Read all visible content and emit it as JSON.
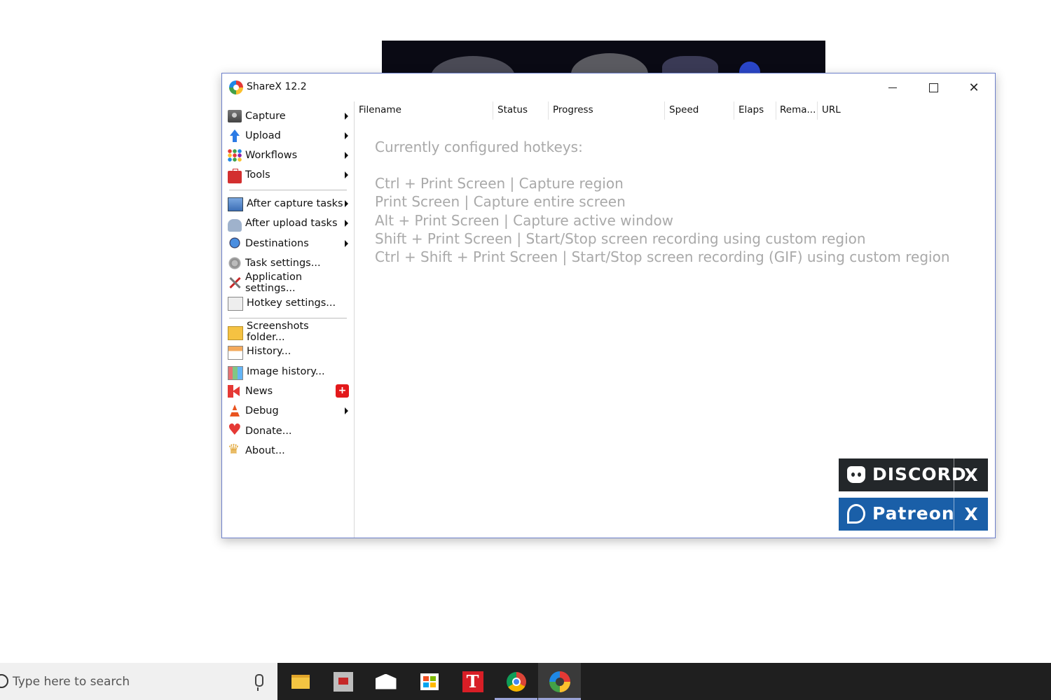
{
  "window": {
    "title": "ShareX 12.2"
  },
  "menu": [
    {
      "label": "Capture",
      "icon": "camera-icon",
      "submenu": true
    },
    {
      "label": "Upload",
      "icon": "upload-arrow-icon",
      "submenu": true
    },
    {
      "label": "Workflows",
      "icon": "workflows-grid-icon",
      "submenu": true
    },
    {
      "label": "Tools",
      "icon": "toolbox-icon",
      "submenu": true
    },
    {
      "label": "After capture tasks",
      "icon": "image-icon",
      "submenu": true
    },
    {
      "label": "After upload tasks",
      "icon": "cloud-icon",
      "submenu": true
    },
    {
      "label": "Destinations",
      "icon": "globe-icon",
      "submenu": true
    },
    {
      "label": "Task settings...",
      "icon": "gear-icon",
      "submenu": false
    },
    {
      "label": "Application settings...",
      "icon": "wrench-screwdriver-icon",
      "submenu": false
    },
    {
      "label": "Hotkey settings...",
      "icon": "keyboard-key-icon",
      "submenu": false
    },
    {
      "label": "Screenshots folder...",
      "icon": "folder-icon",
      "submenu": false
    },
    {
      "label": "History...",
      "icon": "history-icon",
      "submenu": false
    },
    {
      "label": "Image history...",
      "icon": "image-history-icon",
      "submenu": false
    },
    {
      "label": "News",
      "icon": "megaphone-icon",
      "submenu": false,
      "badge": "+"
    },
    {
      "label": "Debug",
      "icon": "traffic-cone-icon",
      "submenu": true
    },
    {
      "label": "Donate...",
      "icon": "heart-icon",
      "submenu": false
    },
    {
      "label": "About...",
      "icon": "crown-icon",
      "submenu": false
    }
  ],
  "columns": [
    "Filename",
    "Status",
    "Progress",
    "Speed",
    "Elaps",
    "Rema...",
    "URL"
  ],
  "hotkeys": {
    "title": "Currently configured hotkeys:",
    "lines": [
      "Ctrl + Print Screen  |  Capture region",
      "Print Screen  |  Capture entire screen",
      "Alt + Print Screen  |  Capture active window",
      "Shift + Print Screen  |  Start/Stop screen recording using custom region",
      "Ctrl + Shift + Print Screen  |  Start/Stop screen recording (GIF) using custom region"
    ]
  },
  "promo": {
    "discord_label": "DISCORD",
    "patreon_label": "Patreon",
    "close_label": "X"
  },
  "taskbar": {
    "search_placeholder": "Type here to search",
    "apps": [
      "file-explorer-icon",
      "app-icon",
      "mail-icon",
      "store-icon",
      "t-app-icon",
      "chrome-icon",
      "sharex-icon"
    ]
  },
  "colors": {
    "window_border": "#6c7fc9",
    "hotkey_text": "#a9a9a9",
    "discord_bg": "#23272a",
    "patreon_bg": "#1a5fa8",
    "taskbar_bg": "#1f1f1f",
    "news_badge": "#e3191b"
  }
}
